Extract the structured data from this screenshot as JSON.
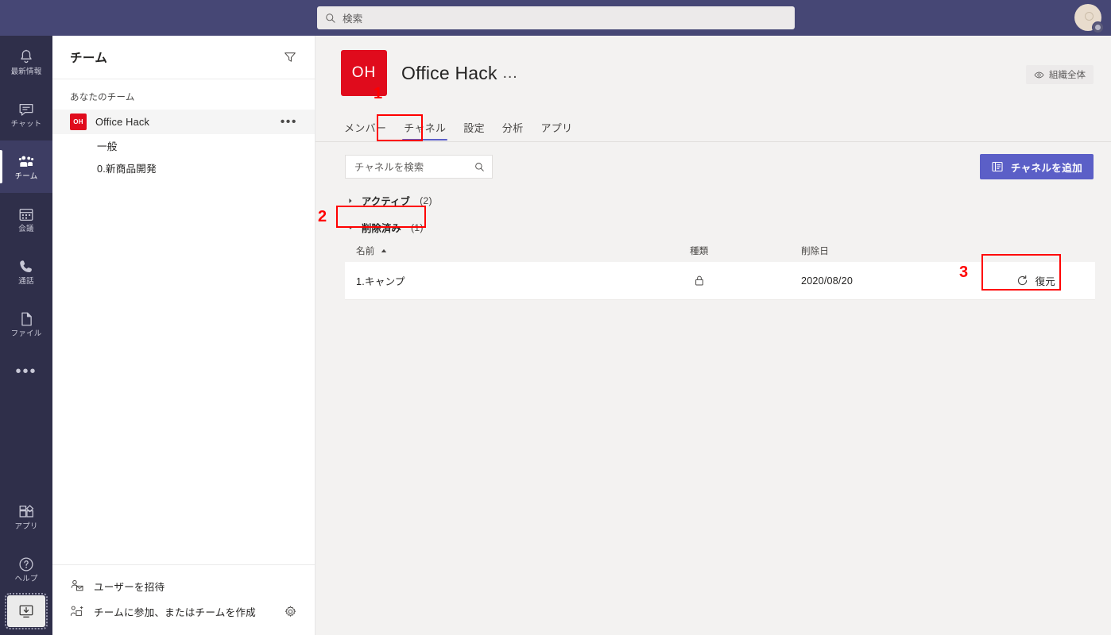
{
  "topbar": {
    "search_placeholder": "検索",
    "search_icon": "search-icon",
    "avatar_name": "user-avatar"
  },
  "rail": {
    "items": [
      {
        "label": "最新情報",
        "icon": "bell-icon",
        "active": false
      },
      {
        "label": "チャット",
        "icon": "chat-icon",
        "active": false
      },
      {
        "label": "チーム",
        "icon": "teams-icon",
        "active": true
      },
      {
        "label": "会議",
        "icon": "calendar-icon",
        "active": false
      },
      {
        "label": "通話",
        "icon": "phone-icon",
        "active": false
      },
      {
        "label": "ファイル",
        "icon": "file-icon",
        "active": false
      }
    ],
    "more_label": "•••",
    "bottom_items": [
      {
        "label": "アプリ",
        "icon": "apps-icon"
      },
      {
        "label": "ヘルプ",
        "icon": "help-icon"
      }
    ],
    "download_icon": "download-app-icon"
  },
  "sidebar": {
    "title": "チーム",
    "filter_icon": "filter-icon",
    "section_label": "あなたのチーム",
    "team": {
      "initials": "OH",
      "name": "Office Hack",
      "more_icon": "more-options-icon"
    },
    "channels": [
      {
        "name": "一般"
      },
      {
        "name": "0.新商品開発"
      }
    ],
    "footer": [
      {
        "label": "ユーザーを招待",
        "icon": "invite-user-icon"
      },
      {
        "label": "チームに参加、またはチームを作成",
        "icon": "join-create-team-icon"
      }
    ],
    "gear_icon": "settings-gear-icon"
  },
  "main": {
    "team_initials": "OH",
    "team_title": "Office Hack",
    "title_more": "…",
    "org_badge": {
      "label": "組織全体",
      "icon": "eye-icon"
    },
    "tabs": [
      {
        "label": "メンバー",
        "active": false
      },
      {
        "label": "チャネル",
        "active": true
      },
      {
        "label": "設定",
        "active": false
      },
      {
        "label": "分析",
        "active": false
      },
      {
        "label": "アプリ",
        "active": false
      }
    ],
    "channel_search_placeholder": "チャネルを検索",
    "channel_search_icon": "search-icon",
    "add_channel_button": {
      "label": "チャネルを追加",
      "icon": "add-channel-icon"
    },
    "groups": [
      {
        "label": "アクティブ",
        "count": "(2)",
        "expanded": false
      },
      {
        "label": "削除済み",
        "count": "(1)",
        "expanded": true
      }
    ],
    "table": {
      "headers": {
        "name": "名前",
        "kind": "種類",
        "date": "削除日",
        "action": ""
      },
      "sort_indicator": "sort-ascending-icon",
      "rows": [
        {
          "name": "1.キャンプ",
          "kind_icon": "lock-icon",
          "date": "2020/08/20",
          "action_label": "復元",
          "action_icon": "restore-icon"
        }
      ]
    }
  },
  "annotations": [
    {
      "number": "1"
    },
    {
      "number": "2"
    },
    {
      "number": "3"
    }
  ],
  "colors": {
    "topbar": "#464775",
    "rail": "#2f2f4a",
    "rail_active": "#3d3d63",
    "accent": "#5b5fc7",
    "team_avatar": "#e00b1c",
    "annotation": "#ff0000",
    "content_bg": "#f3f2f1"
  }
}
